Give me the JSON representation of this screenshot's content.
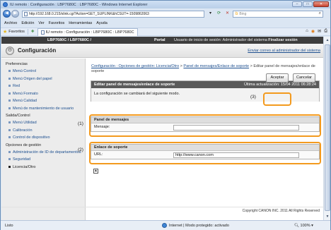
{
  "window": {
    "title": "IU remoto : Configuración : LBP7680C : LBP7680C - Windows Internet Explorer",
    "controls": {
      "min": "–",
      "max": "□",
      "close": "✕"
    }
  },
  "addressbar": {
    "url": "http://192.168.0.215/slink.cgi?Action=GET_SUPLINK&hCSUT=-1509862063",
    "search_placeholder": "Bing"
  },
  "menu": [
    "Archivo",
    "Edición",
    "Ver",
    "Favoritos",
    "Herramientas",
    "Ayuda"
  ],
  "favorites": {
    "label": "Favoritos",
    "tab_title": "IU remoto : Configuración : LBP7680C : LBP7680C"
  },
  "header": {
    "model": "LBP7680C / LBP7680C /",
    "portal": "Portal",
    "login": "Usuario de inicio de sesión: Administrador del sistema",
    "logout": "Finalizar sesión"
  },
  "title": {
    "text": "Configuración",
    "mail_link": "Enviar correo al administrador del sistema"
  },
  "sidebar": {
    "groups": [
      {
        "title": "Preferencias",
        "items": [
          "Menú Control",
          "Menú Origen del papel",
          "Red",
          "Menú Formato",
          "Menú Calidad",
          "Menú de mantenimiento de usuario"
        ]
      },
      {
        "title": "Salida/Control",
        "items": [
          "Menú Utilidad",
          "Calibración",
          "Control de dispositivo"
        ]
      },
      {
        "title": "Opciones de gestión",
        "items": [
          "Administración de ID de departamentos",
          "Seguridad",
          "Licencia/Otro"
        ]
      }
    ]
  },
  "breadcrumb": {
    "link1": "Configuración : Opciones de gestión: Licencia/Otro",
    "link2": "Panel de mensajes/Enlace de soporte",
    "current": "Editar panel de mensajes/enlace de soporte",
    "sep": " > "
  },
  "panel": {
    "title": "Editar panel de mensajes/enlace de soporte",
    "updated": "Última actualización: 15/04 2011 06:28:24",
    "message": "La configuración se cambiará del siguiente modo.",
    "ok": "Aceptar",
    "cancel": "Cancelar"
  },
  "section1": {
    "title": "Panel de mensajes",
    "label": "Mensaje:",
    "value": ""
  },
  "section2": {
    "title": "Enlace de soporte",
    "label": "URL:",
    "value": "http://www.canon.com"
  },
  "callouts": [
    "(1)",
    "(2)",
    "(3)"
  ],
  "footer": {
    "copyright": "Copyright CANON INC. 2011 All Rights Reserved"
  },
  "statusbar": {
    "left": "Listo",
    "zone": "Internet | Modo protegido: activado",
    "zoom": "100%"
  },
  "colors": {
    "highlight": "#f39a1e",
    "header_bg": "#3d3d3d",
    "link": "#1d4f8f"
  }
}
